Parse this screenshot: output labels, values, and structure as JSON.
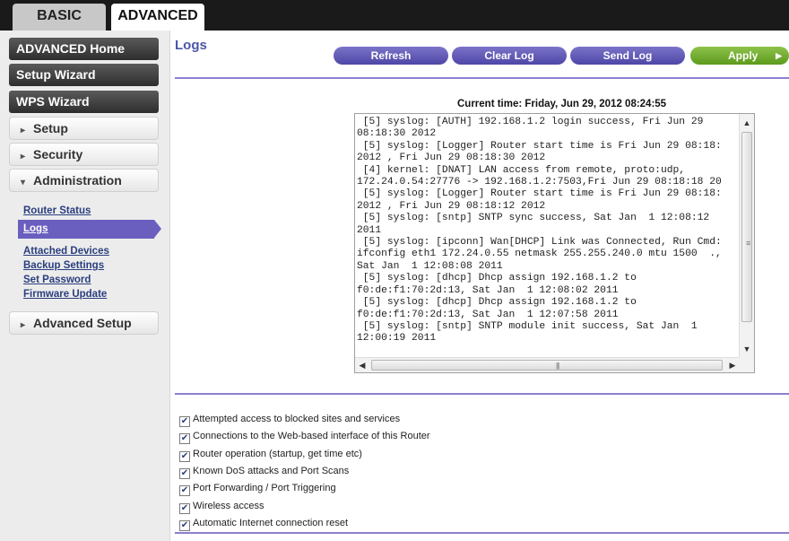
{
  "top_tabs": {
    "basic": "BASIC",
    "advanced": "ADVANCED"
  },
  "sidebar": {
    "advanced_home": "ADVANCED Home",
    "setup_wizard": "Setup Wizard",
    "wps_wizard": "WPS Wizard",
    "setup": "Setup",
    "security": "Security",
    "administration": "Administration",
    "admin_links": {
      "router_status": "Router Status",
      "logs": "Logs",
      "attached_devices": "Attached Devices",
      "backup_settings": "Backup Settings",
      "set_password": "Set Password",
      "firmware_update": "Firmware Update"
    },
    "advanced_setup": "Advanced Setup",
    "collapsed_glyph": "▸",
    "expanded_glyph": "▾"
  },
  "main": {
    "title": "Logs",
    "buttons": {
      "refresh": "Refresh",
      "clear_log": "Clear Log",
      "send_log": "Send Log",
      "apply": "Apply"
    },
    "current_time": "Current time: Friday, Jun 29, 2012 08:24:55",
    "log_text": " [5] syslog: [AUTH] 192.168.1.2 login success, Fri Jun 29\n08:18:30 2012\n [5] syslog: [Logger] Router start time is Fri Jun 29 08:18:\n2012 , Fri Jun 29 08:18:30 2012\n [4] kernel: [DNAT] LAN access from remote, proto:udp,\n172.24.0.54:27776 -> 192.168.1.2:7503,Fri Jun 29 08:18:18 20\n [5] syslog: [Logger] Router start time is Fri Jun 29 08:18:\n2012 , Fri Jun 29 08:18:12 2012\n [5] syslog: [sntp] SNTP sync success, Sat Jan  1 12:08:12\n2011\n [5] syslog: [ipconn] Wan[DHCP] Link was Connected, Run Cmd:\nifconfig eth1 172.24.0.55 netmask 255.255.240.0 mtu 1500  .,\nSat Jan  1 12:08:08 2011\n [5] syslog: [dhcp] Dhcp assign 192.168.1.2 to\nf0:de:f1:70:2d:13, Sat Jan  1 12:08:02 2011\n [5] syslog: [dhcp] Dhcp assign 192.168.1.2 to\nf0:de:f1:70:2d:13, Sat Jan  1 12:07:58 2011\n [5] syslog: [sntp] SNTP module init success, Sat Jan  1\n12:00:19 2011",
    "log_options": [
      {
        "label": "Attempted access to blocked sites and services",
        "checked": true
      },
      {
        "label": "Connections to the Web-based interface of this Router",
        "checked": true
      },
      {
        "label": "Router operation (startup, get time etc)",
        "checked": true
      },
      {
        "label": "Known DoS attacks and Port Scans",
        "checked": true
      },
      {
        "label": "Port Forwarding / Port Triggering",
        "checked": true
      },
      {
        "label": "Wireless access",
        "checked": true
      },
      {
        "label": "Automatic Internet connection reset",
        "checked": true
      }
    ],
    "check_glyph": "✔"
  },
  "colors": {
    "accent_purple": "#6a5fbf",
    "apply_green": "#6ea82c",
    "title_blue": "#4b56a8",
    "link_blue": "#2a3e7e"
  }
}
